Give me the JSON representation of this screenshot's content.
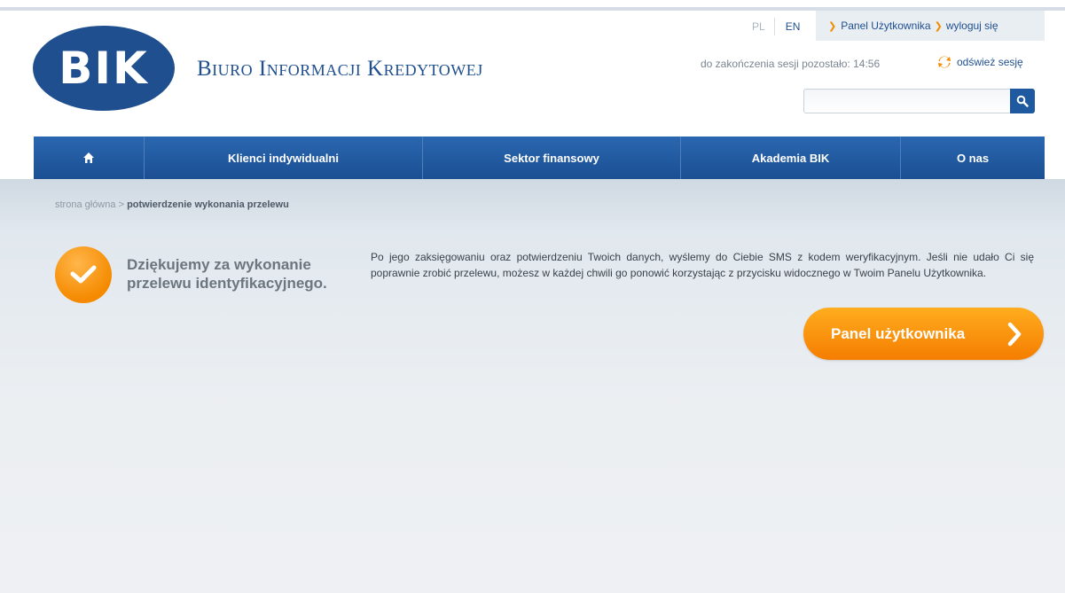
{
  "header": {
    "logo_text": "BIK",
    "brand_name": "Biuro Informacji Kredytowej",
    "lang_pl": "PL",
    "lang_en": "EN",
    "user_panel_link": "Panel Użytkownika",
    "logout_link": "wyloguj się",
    "session_text": "do zakończenia sesji pozostało: 14:56",
    "refresh_label": "odśwież sesję",
    "search": {
      "placeholder": "",
      "value": ""
    }
  },
  "nav": {
    "items": [
      {
        "label": "Klienci indywidualni"
      },
      {
        "label": "Sektor finansowy"
      },
      {
        "label": "Akademia BIK"
      },
      {
        "label": "O nas"
      }
    ]
  },
  "breadcrumb": {
    "home": "strona główna",
    "separator": ">",
    "current": "potwierdzenie wykonania przelewu"
  },
  "main": {
    "thanks_title": "Dziękujemy za wykonanie przelewu identyfikacyjnego.",
    "info_text": "Po jego zaksięgowaniu oraz potwierdzeniu Twoich danych, wyślemy do Ciebie SMS z kodem weryfikacyjnym. Jeśli nie udało Ci się poprawnie zrobić przelewu, możesz w każdej chwili go ponowić korzystając z przycisku widocznego w Twoim Panelu Użytkownika.",
    "panel_button_label": "Panel użytkownika"
  },
  "colors": {
    "brand_blue": "#1f4f8f",
    "nav_blue": "#2a67b0",
    "accent_orange": "#f58a00"
  },
  "icons": [
    "home-icon",
    "search-icon",
    "refresh-icon",
    "check-icon",
    "chevron-right-icon",
    "arrow-right-icon"
  ]
}
